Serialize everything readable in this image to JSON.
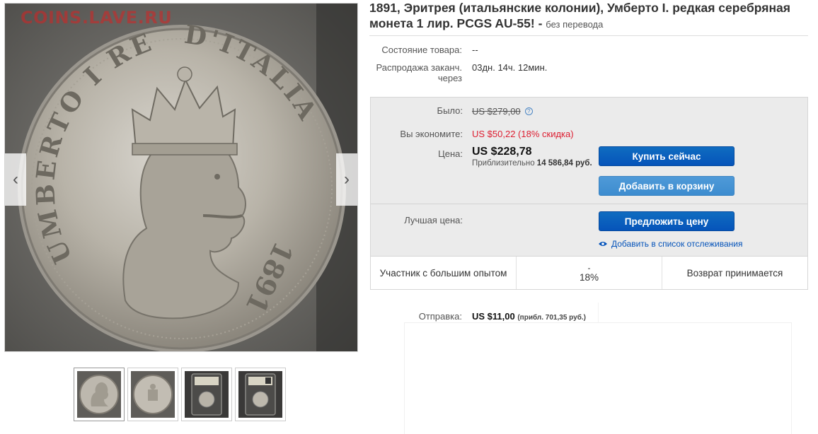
{
  "viewer": {
    "watermark": "COINS.LAVE.RU",
    "prev_arrow": "‹",
    "next_arrow": "›",
    "coin_legend_left": "UMBERTO I RE",
    "coin_legend_right": "D'ITALIA",
    "coin_year": "1891"
  },
  "listing": {
    "title_main": "1891, Эритрея (итальянские колонии), Умберто I. редкая серебряная монета 1 лир. PCGS AU-55! - ",
    "title_note": "без перевода",
    "condition_label": "Состояние товара:",
    "condition_value": "--",
    "ends_label_line1": "Распродажа заканч.",
    "ends_label_line2": "через",
    "ends_value": "03дн. 14ч. 12мин."
  },
  "pricing": {
    "was_label": "Было:",
    "was_value": "US $279,00",
    "save_label": "Вы экономите:",
    "save_value": "US $50,22 (18% скидка)",
    "price_label": "Цена:",
    "price_value": "US $228,78",
    "approx_prefix": "Приблизительно",
    "approx_value": "14 586,84 руб.",
    "buy_now": "Купить сейчас",
    "add_to_cart": "Добавить в корзину",
    "best_offer_label": "Лучшая цена:",
    "make_offer": "Предложить цену",
    "watchlist": "Добавить в список отслеживания"
  },
  "stats": {
    "seller": "Участник с большим опытом",
    "discount_top": "-",
    "discount_bottom": "18%",
    "returns": "Возврат принимается"
  },
  "shipping": {
    "label": "Отправка:",
    "value": "US $11,00",
    "approx": "(прибл. 701,35 руб.)"
  },
  "colors": {
    "primary_button": "#0654ba",
    "secondary_button": "#3d8ccf",
    "discount_red": "#dd1e31",
    "watermark_red": "#d72323"
  }
}
